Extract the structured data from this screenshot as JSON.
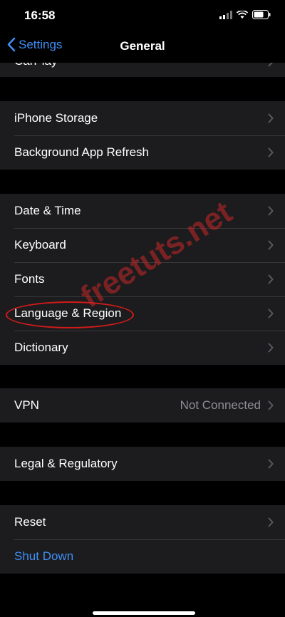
{
  "status": {
    "time": "16:58"
  },
  "nav": {
    "back_label": "Settings",
    "title": "General"
  },
  "partial_item": {
    "label": "CarPlay"
  },
  "groups": {
    "storage": [
      {
        "label": "iPhone Storage"
      },
      {
        "label": "Background App Refresh"
      }
    ],
    "locale": [
      {
        "label": "Date & Time"
      },
      {
        "label": "Keyboard"
      },
      {
        "label": "Fonts"
      },
      {
        "label": "Language & Region"
      },
      {
        "label": "Dictionary"
      }
    ],
    "vpn": [
      {
        "label": "VPN",
        "value": "Not Connected"
      }
    ],
    "legal": [
      {
        "label": "Legal & Regulatory"
      }
    ],
    "reset": [
      {
        "label": "Reset"
      },
      {
        "label": "Shut Down"
      }
    ]
  },
  "watermark": "freetuts.net",
  "colors": {
    "accent": "#3f8ef5",
    "cell_bg": "#1c1c1e",
    "separator": "#38383a",
    "secondary_text": "#8e8e93",
    "annotation": "#d21a1a"
  }
}
